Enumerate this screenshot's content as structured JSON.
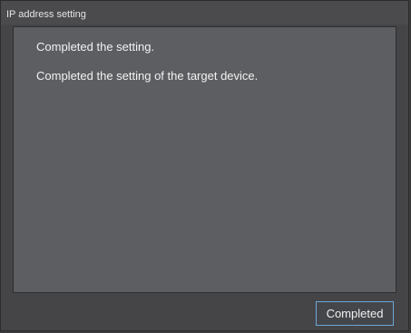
{
  "dialog": {
    "title": "IP address setting",
    "messages": [
      "Completed the setting.",
      "Completed the setting of the target device."
    ],
    "complete_button_label": "Completed"
  },
  "colors": {
    "window_bg": "#454548",
    "content_bg": "#5d5e62",
    "button_border": "#6aa8d8",
    "text": "#f2f2f2"
  }
}
